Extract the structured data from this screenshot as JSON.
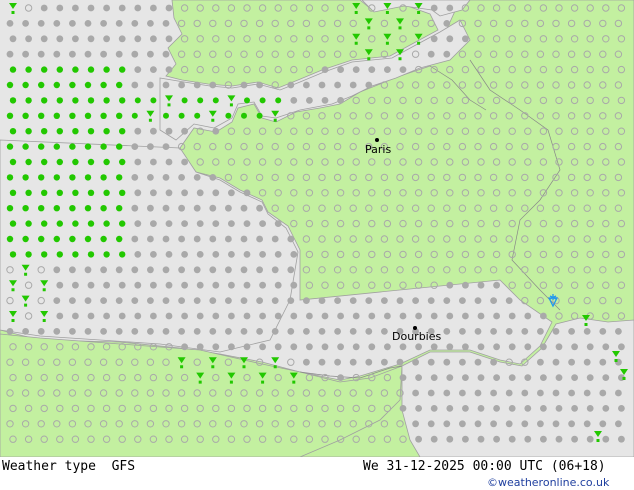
{
  "map": {
    "colors": {
      "sea": "#e6e6e6",
      "land": "#c3f0a0",
      "coast": "#a0a0a0",
      "border": "#888888",
      "no_precip_symbol": "#a9a9a9",
      "rain_symbol": "#22c800",
      "snow_symbol": "#2299ee"
    },
    "cities": [
      {
        "name": "Paris",
        "symbol": "city-dot"
      },
      {
        "name": "Dourbies",
        "symbol": "city-dot"
      }
    ],
    "symbol_legend": [
      "no-precipitation-circle-icon",
      "rain-drop-icon",
      "rain-shower-icon",
      "snowflake-shower-icon"
    ]
  },
  "footer": {
    "left_label": "Weather type  GFS",
    "datetime": "We 31-12-2025 00:00 UTC (06+18)",
    "credit": "©weatheronline.co.uk"
  }
}
